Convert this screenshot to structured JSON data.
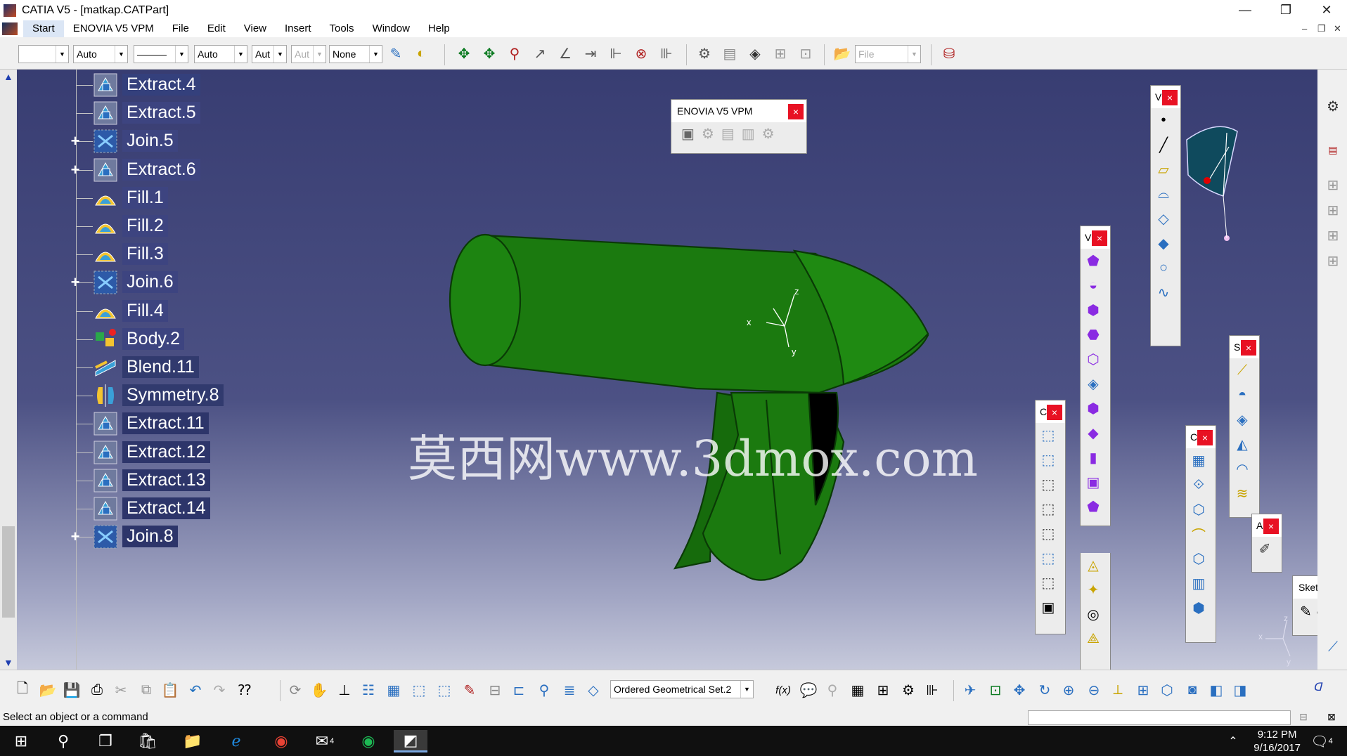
{
  "window": {
    "title": "CATIA V5 - [matkap.CATPart]",
    "minimize": "—",
    "restore": "❐",
    "close": "✕",
    "mdi": [
      "–",
      "❐",
      "✕"
    ]
  },
  "menu": [
    "Start",
    "ENOVIA V5 VPM",
    "File",
    "Edit",
    "View",
    "Insert",
    "Tools",
    "Window",
    "Help"
  ],
  "toolbar": {
    "combo1": "",
    "color": "Auto",
    "line": "———",
    "linewidth": "Auto",
    "weight": "Aut",
    "layer_disabled": "Aut",
    "style": "None",
    "file_combo": "File"
  },
  "tree": {
    "nodes": [
      {
        "label": "Extract.4",
        "icon": "extract-icon",
        "expandable": false,
        "bg": "#34407c"
      },
      {
        "label": "Extract.5",
        "icon": "extract-icon",
        "expandable": false,
        "bg": "#3d4480"
      },
      {
        "label": "Join.5",
        "icon": "join-icon",
        "expandable": true,
        "bg": "#3d4480"
      },
      {
        "label": "Extract.6",
        "icon": "extract-icon",
        "expandable": true,
        "bg": "#3d4480"
      },
      {
        "label": "Fill.1",
        "icon": "fill-icon",
        "expandable": false,
        "bg": "#3d4480"
      },
      {
        "label": "Fill.2",
        "icon": "fill-icon",
        "expandable": false,
        "bg": "#3d4480"
      },
      {
        "label": "Fill.3",
        "icon": "fill-icon",
        "expandable": false,
        "bg": "#3d4480"
      },
      {
        "label": "Join.6",
        "icon": "join-icon",
        "expandable": true,
        "bg": "#3d4480"
      },
      {
        "label": "Fill.4",
        "icon": "fill-icon",
        "expandable": false,
        "bg": "#3d4480"
      },
      {
        "label": "Body.2",
        "icon": "body-icon",
        "expandable": false,
        "bg": "#3d4480"
      },
      {
        "label": "Blend.11",
        "icon": "blend-icon",
        "expandable": false,
        "bg": "#313a6e"
      },
      {
        "label": "Symmetry.8",
        "icon": "symmetry-icon",
        "expandable": false,
        "bg": "#313a6e"
      },
      {
        "label": "Extract.11",
        "icon": "extract-icon",
        "expandable": false,
        "bg": "#2d356a"
      },
      {
        "label": "Extract.12",
        "icon": "extract-icon",
        "expandable": false,
        "bg": "#2d356a"
      },
      {
        "label": "Extract.13",
        "icon": "extract-icon",
        "expandable": false,
        "bg": "#2d356a"
      },
      {
        "label": "Extract.14",
        "icon": "extract-icon",
        "expandable": false,
        "bg": "#2d356a"
      },
      {
        "label": "Join.8",
        "icon": "join-icon",
        "expandable": true,
        "bg": "#2d356a"
      }
    ]
  },
  "panels": {
    "enovia": "ENOVIA V5 VPM",
    "v1": "V",
    "v2": "V",
    "c1": "C",
    "s1": "S",
    "c2": "C",
    "a1": "A",
    "sketch": "Sketch...",
    "close": "×"
  },
  "watermark": "莫西网www.3dmox.com",
  "axis": {
    "x": "x",
    "y": "y",
    "z": "z"
  },
  "bottom": {
    "ordered_set": "Ordered Geometrical Set.2",
    "fx": "f(x)"
  },
  "status": "Select an object or a command",
  "taskbar": {
    "time": "9:12 PM",
    "date": "9/16/2017",
    "mail_badge": "4",
    "notif": "4"
  },
  "colors": {
    "model": "#1b7a0f",
    "viewport_top": "#383d72",
    "tree_label": "#34407c",
    "close_red": "#e81123"
  }
}
